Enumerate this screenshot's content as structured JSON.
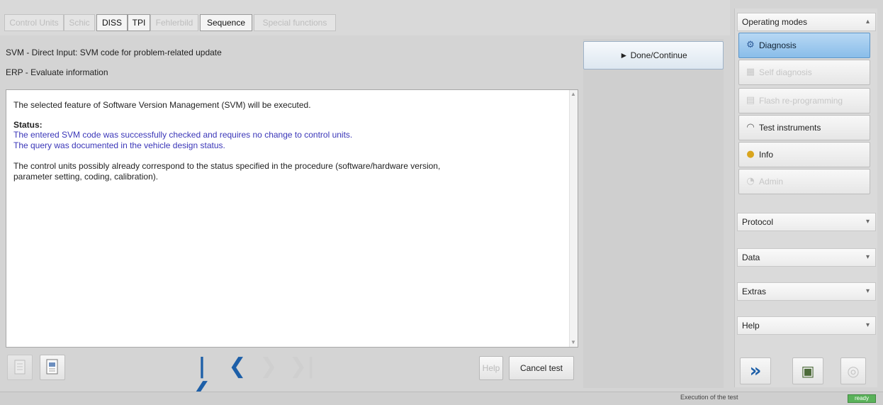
{
  "tabs": [
    {
      "label": "Control Units",
      "active": false
    },
    {
      "label": "Schic",
      "active": false
    },
    {
      "label": "DISS",
      "active": true
    },
    {
      "label": "TPI",
      "active": true
    },
    {
      "label": "Fehlerbild",
      "active": false
    },
    {
      "label": "Sequence",
      "active": true
    },
    {
      "label": "Special functions",
      "active": false
    }
  ],
  "header": {
    "line1": "SVM - Direct Input: SVM code for problem-related update",
    "line2": "ERP - Evaluate information"
  },
  "message": {
    "intro": "The selected feature of Software Version Management (SVM) will be executed.",
    "status_label": "Status:",
    "status_line1": "The entered SVM code was successfully checked and requires no change to control units.",
    "status_line2": "The query was documented in the vehicle design status.",
    "note_line1": "The control units possibly already correspond to the status specified in the procedure (software/hardware version,",
    "note_line2": "parameter setting, coding, calibration)."
  },
  "toolbar": {
    "first_glyph": "|❮",
    "prev_glyph": "❮",
    "next_glyph": "❯",
    "last_glyph": "❯|",
    "help_label": "Help",
    "cancel_label": "Cancel test"
  },
  "done_button": {
    "label": "► Done/Continue"
  },
  "sidebar": {
    "operating_modes": {
      "title": "Operating modes",
      "arrow": "▴"
    },
    "modes": [
      {
        "label": "Diagnosis",
        "state": "active",
        "icon": "diagnosis-icon",
        "glyph": "⚙"
      },
      {
        "label": "Self diagnosis",
        "state": "disabled",
        "icon": "self-diagnosis-icon",
        "glyph": "▦"
      },
      {
        "label": "Flash re-programming",
        "state": "disabled",
        "icon": "flash-icon",
        "glyph": "▤"
      },
      {
        "label": "Test instruments",
        "state": "normal",
        "icon": "test-instruments-icon",
        "glyph": "◠"
      },
      {
        "label": "Info",
        "state": "normal",
        "icon": "info-icon",
        "glyph": "●"
      },
      {
        "label": "Admin",
        "state": "disabled",
        "icon": "admin-icon",
        "glyph": "◔"
      }
    ],
    "sections": [
      {
        "label": "Protocol",
        "arrow": "▾"
      },
      {
        "label": "Data",
        "arrow": "▾"
      },
      {
        "label": "Extras",
        "arrow": "▾"
      },
      {
        "label": "Help",
        "arrow": "▾"
      }
    ],
    "tools": {
      "forward_glyph": "»",
      "screenshot_glyph": "▣",
      "disc_glyph": "◎"
    }
  },
  "status": {
    "text": "Execution of the test",
    "indicator": "ready"
  },
  "colors": {
    "status_blue": "#3a36b8",
    "active_mode": "#89bde9",
    "indicator_green": "#5ab25a"
  }
}
